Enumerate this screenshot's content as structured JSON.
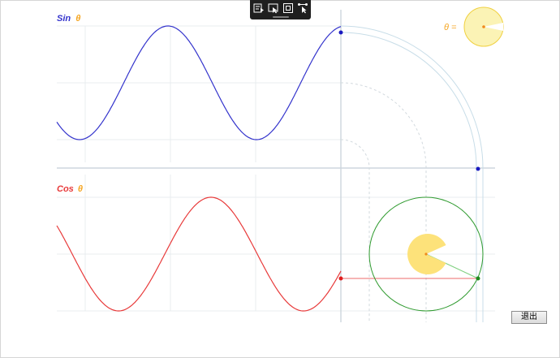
{
  "sin_panel": {
    "label_fn": "Sin",
    "label_theta": "θ",
    "color": "#3333cc",
    "theta_color": "#f5a623"
  },
  "cos_panel": {
    "label_fn": "Cos",
    "label_theta": "θ",
    "color": "#e83a3a",
    "theta_color": "#f5a623"
  },
  "theta_indicator": {
    "label": "θ =",
    "fill": "#fbf3b5",
    "stroke": "#f0d040"
  },
  "angle_pie": {
    "fill": "#fde27a"
  },
  "unit_circle": {
    "stroke": "#2e9a2e"
  },
  "toolbar": {
    "icons": [
      "play-list-icon",
      "pointer-icon",
      "fullscreen-icon",
      "connect-icon"
    ]
  },
  "exit_button": {
    "label": "退出"
  }
}
